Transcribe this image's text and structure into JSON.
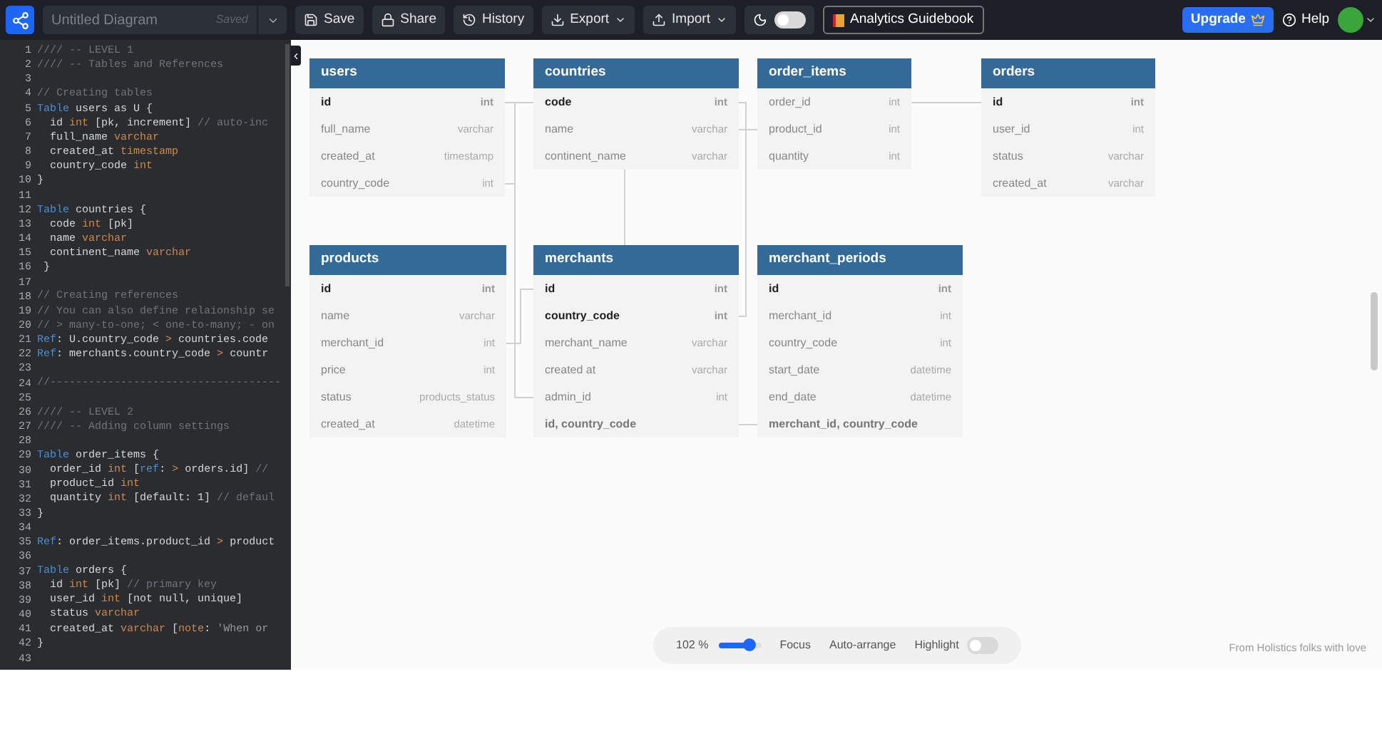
{
  "toolbar": {
    "title_field": {
      "value": "Untitled Diagram",
      "status": "Saved"
    },
    "buttons": [
      {
        "kind": "save",
        "label": "Save"
      },
      {
        "kind": "share",
        "label": "Share"
      },
      {
        "kind": "history",
        "label": "History"
      },
      {
        "kind": "export",
        "label": "Export"
      },
      {
        "kind": "import",
        "label": "Import"
      }
    ],
    "theme_toggle": {
      "on": false
    },
    "guide_button": "Analytics Guidebook",
    "upgrade_button": "Upgrade",
    "help_link": "Help"
  },
  "editor": {
    "lines": [
      {
        "number": "1",
        "segments": [
          {
            "kind": "comment",
            "text": "//// -- LEVEL 1"
          }
        ]
      },
      {
        "number": "2",
        "segments": [
          {
            "kind": "comment",
            "text": "//// -- Tables and References"
          }
        ]
      },
      {
        "number": "3"
      },
      {
        "number": "4",
        "segments": [
          {
            "kind": "comment",
            "text": "// Creating tables"
          }
        ]
      },
      {
        "number": "5",
        "segments": [
          {
            "kind": "keyword",
            "text": "Table"
          },
          {
            "kind": "plain",
            "text": " users as U {"
          }
        ]
      },
      {
        "number": "6",
        "segments": [
          {
            "kind": "plain",
            "text": "  id "
          },
          {
            "kind": "type",
            "text": "int"
          },
          {
            "kind": "plain",
            "text": " [pk, increment] "
          },
          {
            "kind": "comment",
            "text": "// auto-inc"
          }
        ]
      },
      {
        "number": "7",
        "segments": [
          {
            "kind": "plain",
            "text": "  full_name "
          },
          {
            "kind": "type",
            "text": "varchar"
          }
        ]
      },
      {
        "number": "8",
        "segments": [
          {
            "kind": "plain",
            "text": "  created_at "
          },
          {
            "kind": "type",
            "text": "timestamp"
          }
        ]
      },
      {
        "number": "9",
        "segments": [
          {
            "kind": "plain",
            "text": "  country_code "
          },
          {
            "kind": "type",
            "text": "int"
          }
        ]
      },
      {
        "number": "10",
        "segments": [
          {
            "kind": "plain",
            "text": "}"
          }
        ]
      },
      {
        "number": "11"
      },
      {
        "number": "12",
        "segments": [
          {
            "kind": "keyword",
            "text": "Table"
          },
          {
            "kind": "plain",
            "text": " countries {"
          }
        ]
      },
      {
        "number": "13",
        "segments": [
          {
            "kind": "plain",
            "text": "  code "
          },
          {
            "kind": "type",
            "text": "int"
          },
          {
            "kind": "plain",
            "text": " [pk]"
          }
        ]
      },
      {
        "number": "14",
        "segments": [
          {
            "kind": "plain",
            "text": "  name "
          },
          {
            "kind": "type",
            "text": "varchar"
          }
        ]
      },
      {
        "number": "15",
        "segments": [
          {
            "kind": "plain",
            "text": "  continent_name "
          },
          {
            "kind": "type",
            "text": "varchar"
          }
        ]
      },
      {
        "number": "16",
        "segments": [
          {
            "kind": "plain",
            "text": " }"
          }
        ]
      },
      {
        "number": "17"
      },
      {
        "number": "18",
        "segments": [
          {
            "kind": "comment",
            "text": "// Creating references"
          }
        ]
      },
      {
        "number": "19",
        "segments": [
          {
            "kind": "comment",
            "text": "// You can also define relaionship se"
          }
        ]
      },
      {
        "number": "20",
        "segments": [
          {
            "kind": "comment",
            "text": "// > many-to-one; < one-to-many; - on"
          }
        ]
      },
      {
        "number": "21",
        "segments": [
          {
            "kind": "keyword",
            "text": "Ref"
          },
          {
            "kind": "plain",
            "text": ": U.country_code "
          },
          {
            "kind": "operator",
            "text": ">"
          },
          {
            "kind": "plain",
            "text": " countries.code"
          }
        ]
      },
      {
        "number": "22",
        "segments": [
          {
            "kind": "keyword",
            "text": "Ref"
          },
          {
            "kind": "plain",
            "text": ": merchants.country_code "
          },
          {
            "kind": "operator",
            "text": ">"
          },
          {
            "kind": "plain",
            "text": " countr"
          }
        ]
      },
      {
        "number": "23"
      },
      {
        "number": "24",
        "segments": [
          {
            "kind": "comment",
            "text": "//------------------------------------"
          }
        ]
      },
      {
        "number": "25"
      },
      {
        "number": "26",
        "segments": [
          {
            "kind": "comment",
            "text": "//// -- LEVEL 2"
          }
        ]
      },
      {
        "number": "27",
        "segments": [
          {
            "kind": "comment",
            "text": "//// -- Adding column settings"
          }
        ]
      },
      {
        "number": "28"
      },
      {
        "number": "29",
        "segments": [
          {
            "kind": "keyword",
            "text": "Table"
          },
          {
            "kind": "plain",
            "text": " order_items {"
          }
        ]
      },
      {
        "number": "30",
        "segments": [
          {
            "kind": "plain",
            "text": "  order_id "
          },
          {
            "kind": "type",
            "text": "int"
          },
          {
            "kind": "plain",
            "text": " ["
          },
          {
            "kind": "keyword",
            "text": "ref"
          },
          {
            "kind": "plain",
            "text": ": "
          },
          {
            "kind": "operator",
            "text": ">"
          },
          {
            "kind": "plain",
            "text": " orders.id] "
          },
          {
            "kind": "comment",
            "text": "//"
          }
        ]
      },
      {
        "number": "31",
        "segments": [
          {
            "kind": "plain",
            "text": "  product_id "
          },
          {
            "kind": "type",
            "text": "int"
          }
        ]
      },
      {
        "number": "32",
        "segments": [
          {
            "kind": "plain",
            "text": "  quantity "
          },
          {
            "kind": "type",
            "text": "int"
          },
          {
            "kind": "plain",
            "text": " [default: 1] "
          },
          {
            "kind": "comment",
            "text": "// defaul"
          }
        ]
      },
      {
        "number": "33",
        "segments": [
          {
            "kind": "plain",
            "text": "}"
          }
        ]
      },
      {
        "number": "34"
      },
      {
        "number": "35",
        "segments": [
          {
            "kind": "keyword",
            "text": "Ref"
          },
          {
            "kind": "plain",
            "text": ": order_items.product_id "
          },
          {
            "kind": "operator",
            "text": ">"
          },
          {
            "kind": "plain",
            "text": " product"
          }
        ]
      },
      {
        "number": "36"
      },
      {
        "number": "37",
        "segments": [
          {
            "kind": "keyword",
            "text": "Table"
          },
          {
            "kind": "plain",
            "text": " orders {"
          }
        ]
      },
      {
        "number": "38",
        "segments": [
          {
            "kind": "plain",
            "text": "  id "
          },
          {
            "kind": "type",
            "text": "int"
          },
          {
            "kind": "plain",
            "text": " [pk] "
          },
          {
            "kind": "comment",
            "text": "// primary key"
          }
        ]
      },
      {
        "number": "39",
        "segments": [
          {
            "kind": "plain",
            "text": "  user_id "
          },
          {
            "kind": "type",
            "text": "int"
          },
          {
            "kind": "plain",
            "text": " [not null, unique]"
          }
        ]
      },
      {
        "number": "40",
        "segments": [
          {
            "kind": "plain",
            "text": "  status "
          },
          {
            "kind": "type",
            "text": "varchar"
          }
        ]
      },
      {
        "number": "41",
        "segments": [
          {
            "kind": "plain",
            "text": "  created_at "
          },
          {
            "kind": "type",
            "text": "varchar"
          },
          {
            "kind": "plain",
            "text": " ["
          },
          {
            "kind": "type",
            "text": "note"
          },
          {
            "kind": "plain",
            "text": ": "
          },
          {
            "kind": "string",
            "text": "'When or"
          }
        ]
      },
      {
        "number": "42",
        "segments": [
          {
            "kind": "plain",
            "text": "}"
          }
        ]
      },
      {
        "number": "43"
      }
    ]
  },
  "diagram": {
    "tables": [
      {
        "name": "users",
        "columns": [
          {
            "name": "id",
            "type": "int",
            "kind": "pk"
          },
          {
            "name": "full_name",
            "type": "varchar",
            "kind": "field"
          },
          {
            "name": "created_at",
            "type": "timestamp",
            "kind": "field"
          },
          {
            "name": "country_code",
            "type": "int",
            "kind": "field"
          }
        ]
      },
      {
        "name": "countries",
        "columns": [
          {
            "name": "code",
            "type": "int",
            "kind": "pk"
          },
          {
            "name": "name",
            "type": "varchar",
            "kind": "field"
          },
          {
            "name": "continent_name",
            "type": "varchar",
            "kind": "field"
          }
        ]
      },
      {
        "name": "order_items",
        "columns": [
          {
            "name": "order_id",
            "type": "int",
            "kind": "field"
          },
          {
            "name": "product_id",
            "type": "int",
            "kind": "field"
          },
          {
            "name": "quantity",
            "type": "int",
            "kind": "field"
          }
        ]
      },
      {
        "name": "orders",
        "columns": [
          {
            "name": "id",
            "type": "int",
            "kind": "pk"
          },
          {
            "name": "user_id",
            "type": "int",
            "kind": "field"
          },
          {
            "name": "status",
            "type": "varchar",
            "kind": "field"
          },
          {
            "name": "created_at",
            "type": "varchar",
            "kind": "field"
          }
        ]
      },
      {
        "name": "products",
        "columns": [
          {
            "name": "id",
            "type": "int",
            "kind": "pk"
          },
          {
            "name": "name",
            "type": "varchar",
            "kind": "field"
          },
          {
            "name": "merchant_id",
            "type": "int",
            "kind": "field"
          },
          {
            "name": "price",
            "type": "int",
            "kind": "field"
          },
          {
            "name": "status",
            "type": "products_status",
            "kind": "field"
          },
          {
            "name": "created_at",
            "type": "datetime",
            "kind": "field"
          }
        ]
      },
      {
        "name": "merchants",
        "columns": [
          {
            "name": "id",
            "type": "int",
            "kind": "pk"
          },
          {
            "name": "country_code",
            "type": "int",
            "kind": "pk"
          },
          {
            "name": "merchant_name",
            "type": "varchar",
            "kind": "field"
          },
          {
            "name": "created at",
            "type": "varchar",
            "kind": "field"
          },
          {
            "name": "admin_id",
            "type": "int",
            "kind": "field"
          },
          {
            "name": "id, country_code",
            "kind": "index"
          }
        ]
      },
      {
        "name": "merchant_periods",
        "columns": [
          {
            "name": "id",
            "type": "int",
            "kind": "pk"
          },
          {
            "name": "merchant_id",
            "type": "int",
            "kind": "field"
          },
          {
            "name": "country_code",
            "type": "int",
            "kind": "field"
          },
          {
            "name": "start_date",
            "type": "datetime",
            "kind": "field"
          },
          {
            "name": "end_date",
            "type": "datetime",
            "kind": "field"
          },
          {
            "name": "merchant_id, country_code",
            "kind": "index"
          }
        ]
      }
    ]
  },
  "controls": {
    "zoom": "102 %",
    "zoom_slider": {
      "level": 0.7
    },
    "focus": "Focus",
    "auto_arrange": "Auto-arrange",
    "highlight": {
      "label": "Highlight",
      "on": false
    }
  },
  "footer": "From Holistics folks with love"
}
